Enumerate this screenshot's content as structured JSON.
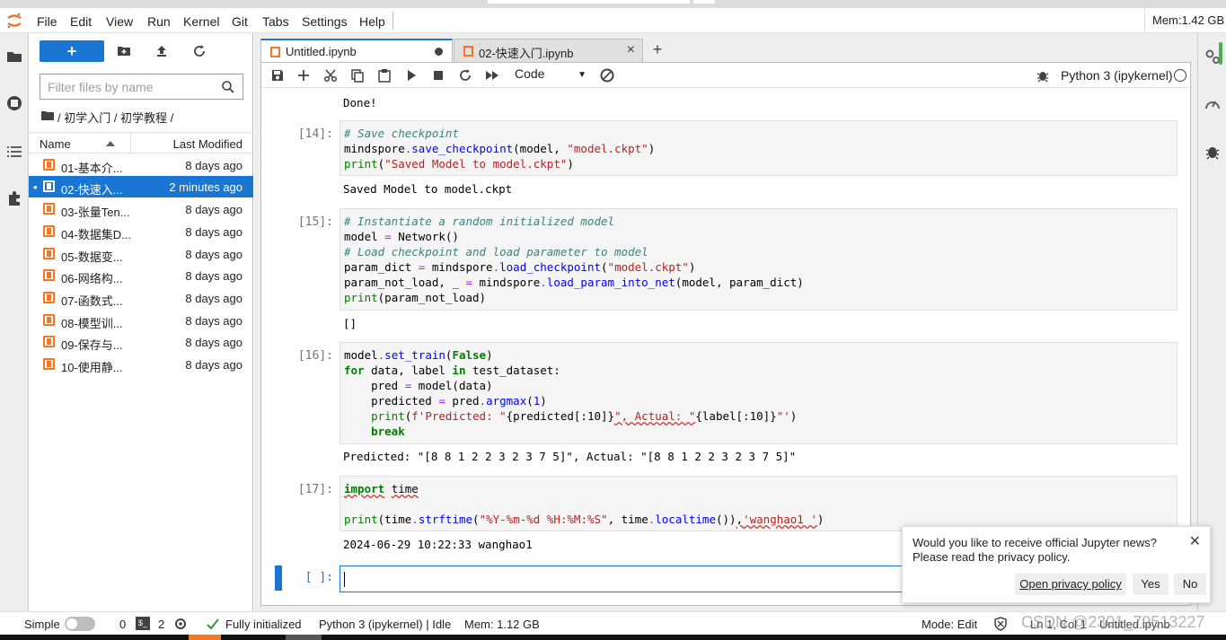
{
  "menubar": {
    "items": [
      "File",
      "Edit",
      "View",
      "Run",
      "Kernel",
      "Git",
      "Tabs",
      "Settings",
      "Help"
    ],
    "mem": "Mem:1.42 GB"
  },
  "filebrowser": {
    "new_label": "+",
    "filter_placeholder": "Filter files by name",
    "breadcrumb": "/ 初学入门 / 初学教程 /",
    "col_name": "Name",
    "col_modified": "Last Modified",
    "files": [
      {
        "name": "01-基本介...",
        "modified": "8 days ago"
      },
      {
        "name": "02-快速入...",
        "modified": "2 minutes ago",
        "selected": true
      },
      {
        "name": "03-张量Ten...",
        "modified": "8 days ago"
      },
      {
        "name": "04-数据集D...",
        "modified": "8 days ago"
      },
      {
        "name": "05-数据变...",
        "modified": "8 days ago"
      },
      {
        "name": "06-网络构...",
        "modified": "8 days ago"
      },
      {
        "name": "07-函数式...",
        "modified": "8 days ago"
      },
      {
        "name": "08-模型训...",
        "modified": "8 days ago"
      },
      {
        "name": "09-保存与...",
        "modified": "8 days ago"
      },
      {
        "name": "10-使用静...",
        "modified": "8 days ago"
      }
    ],
    "running_dot": "•"
  },
  "tabs": [
    {
      "label": "Untitled.ipynb",
      "active": true
    },
    {
      "label": "02-快速入门.ipynb",
      "active": false
    }
  ],
  "toolbar": {
    "cell_type": "Code",
    "kernel": "Python 3 (ipykernel)"
  },
  "cells": {
    "out_done": "Done!",
    "p14": "[14]:",
    "out14": "Saved Model to model.ckpt",
    "p15": "[15]:",
    "out15": "[]",
    "p16": "[16]:",
    "out16": "Predicted: \"[8 8 1 2 2 3 2 3 7 5]\", Actual: \"[8 8 1 2 2 3 2 3 7 5]\"",
    "p17": "[17]:",
    "out17": "2024-06-29 10:22:33 wanghao1",
    "p_empty": "[ ]:"
  },
  "notification": {
    "line1": "Would you like to receive official Jupyter news?",
    "line2": "Please read the privacy policy.",
    "open_btn": "Open privacy policy",
    "yes_btn": "Yes",
    "no_btn": "No",
    "close": "✕"
  },
  "statusbar": {
    "simple": "Simple",
    "terminals": "0",
    "term_icon": "$_",
    "kernels": "2",
    "initialized": "Fully initialized",
    "kernel_status": "Python 3 (ipykernel) | Idle",
    "mem": "Mem: 1.12 GB",
    "mode": "Mode: Edit",
    "position": "Ln 1, Col 1",
    "file": "Untitled.ipynb",
    "watermark": "CSDN @2301_79513227"
  }
}
